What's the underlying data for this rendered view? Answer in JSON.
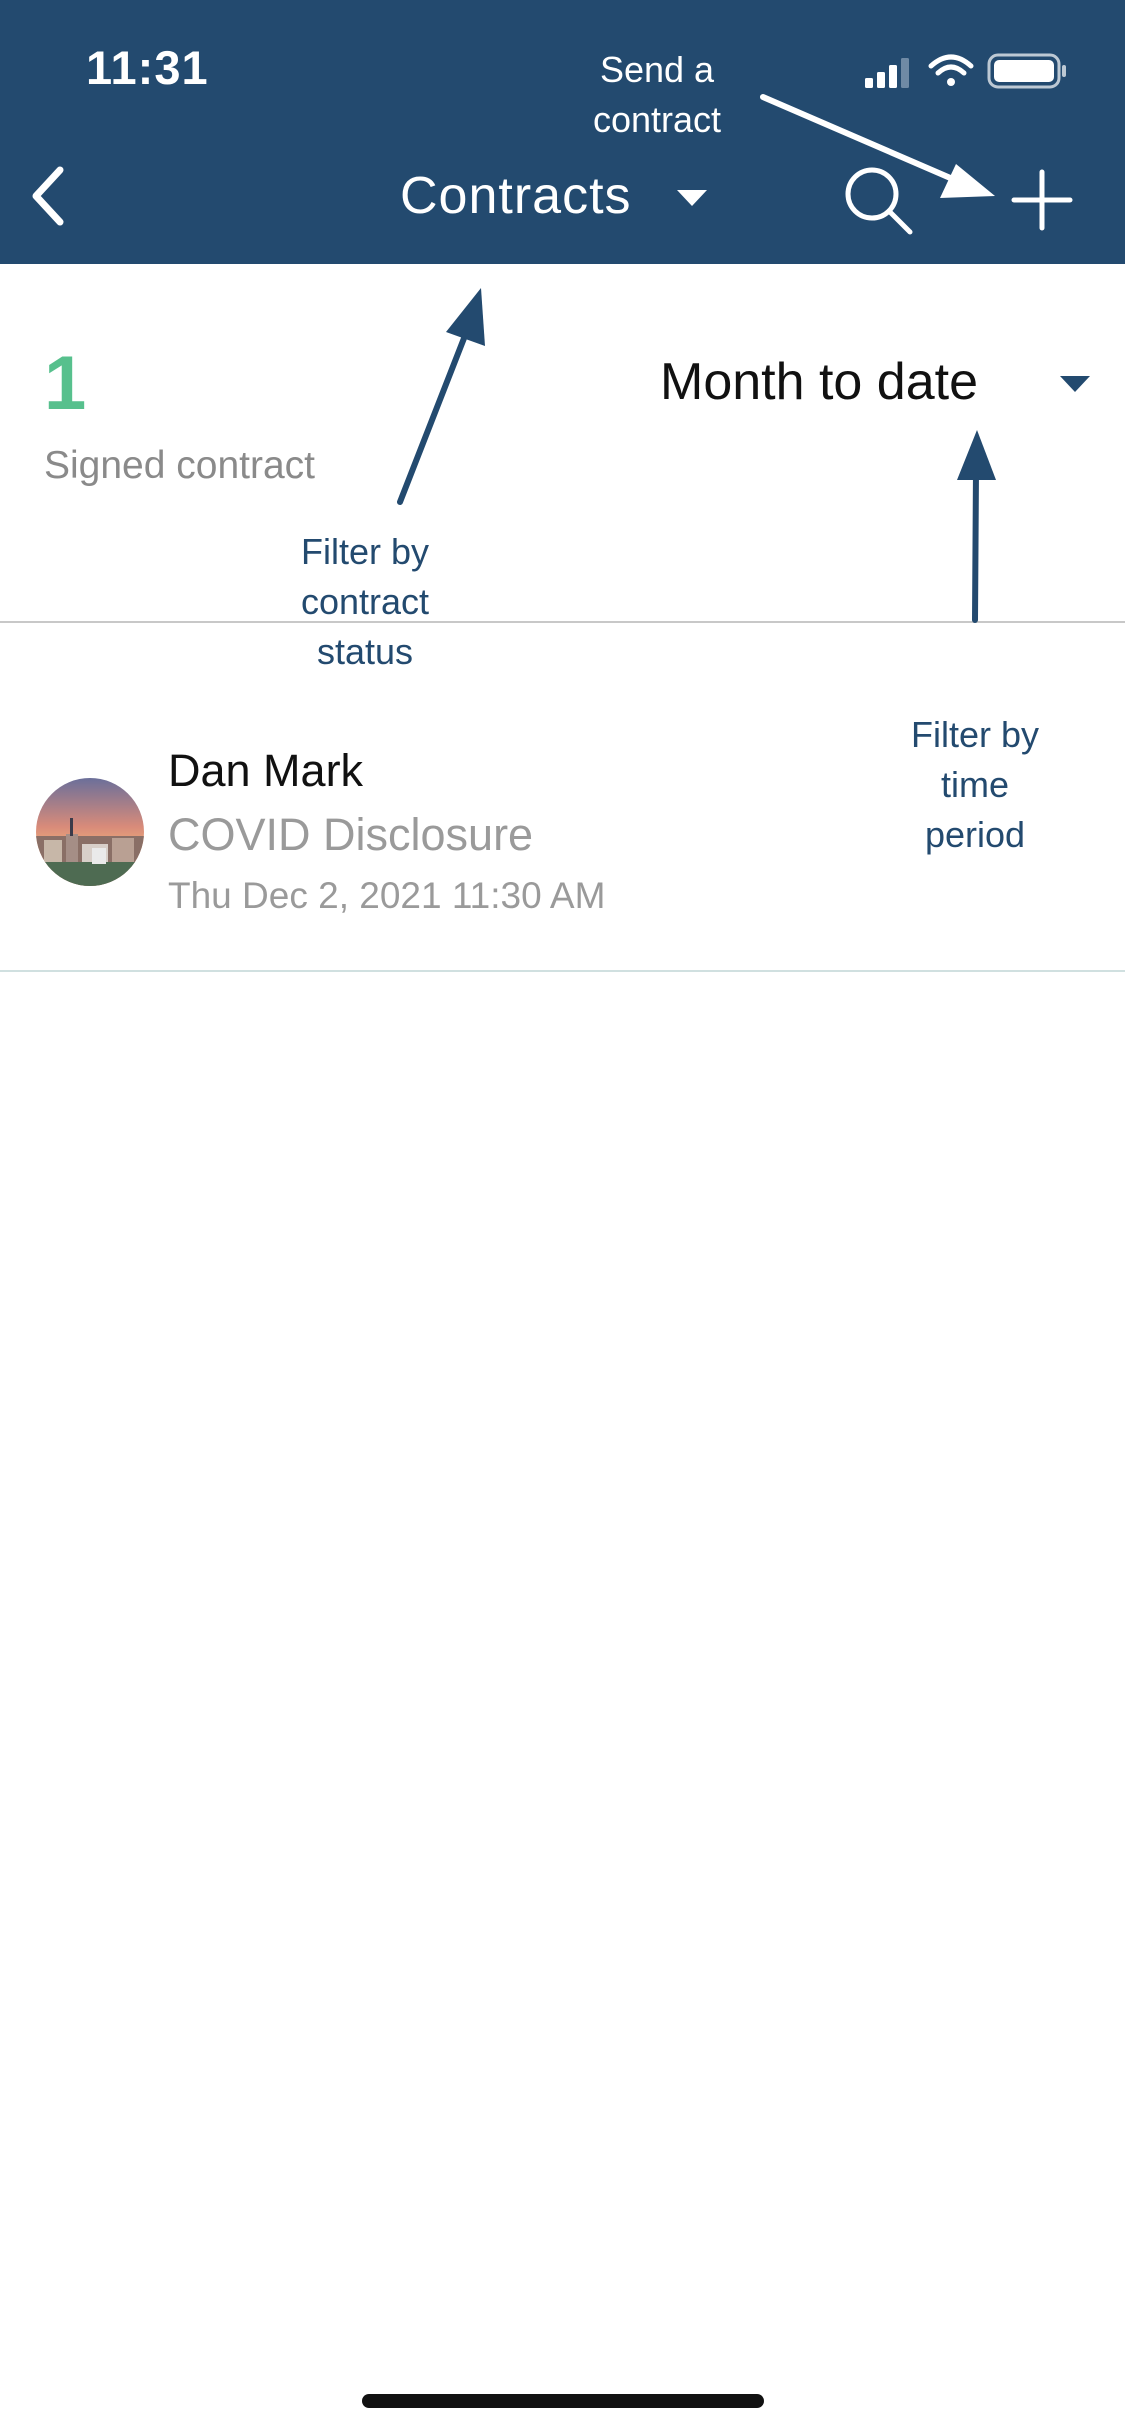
{
  "status_bar": {
    "time": "11:31"
  },
  "header": {
    "title": "Contracts",
    "back_icon": "chevron-left-icon",
    "search_icon": "search-icon",
    "add_icon": "plus-icon"
  },
  "summary": {
    "signed_count": "1",
    "signed_label": "Signed contract",
    "period_label": "Month to date"
  },
  "contracts": [
    {
      "contact_name": "Dan Mark",
      "contract_name": "COVID Disclosure",
      "date": "Thu Dec 2, 2021 11:30 AM"
    }
  ],
  "annotations": {
    "send_line1": "Send a",
    "send_line2": "contract",
    "status_line1": "Filter by",
    "status_line2": "contract",
    "status_line3": "status",
    "period_line1": "Filter by",
    "period_line2": "time",
    "period_line3": "period"
  },
  "colors": {
    "header_bg": "#234a6f",
    "accent_green": "#57c08d",
    "annotation_navy": "#234a6f"
  }
}
